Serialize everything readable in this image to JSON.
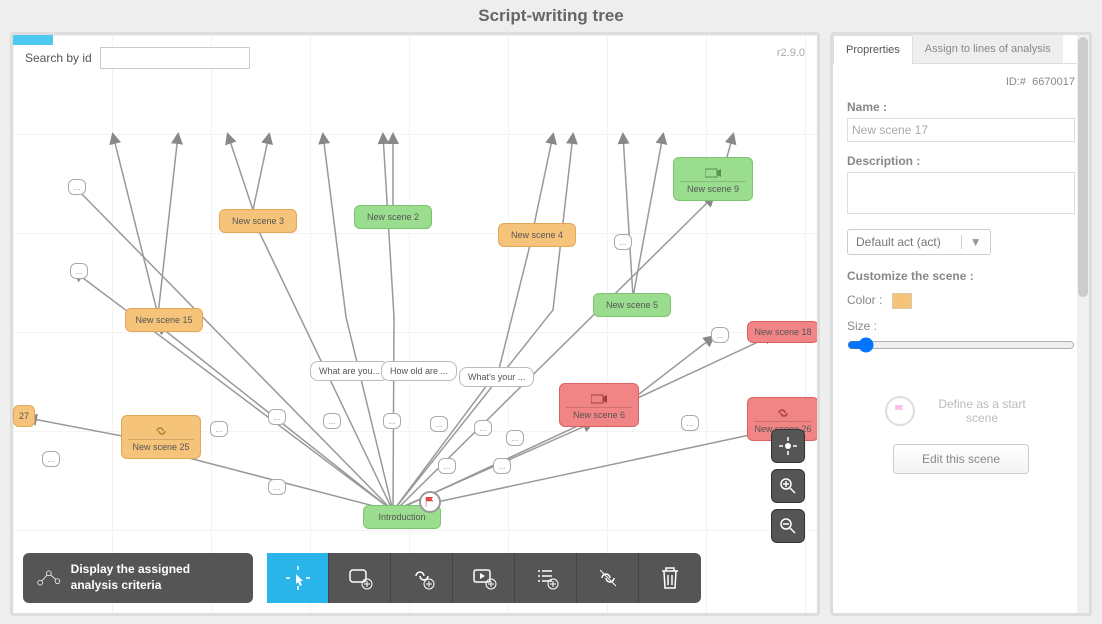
{
  "title": "Script-writing tree",
  "search": {
    "label": "Search by id",
    "value": ""
  },
  "version": "r2.9.0",
  "nodes": {
    "intro": "Introduction",
    "s2": "New scene 2",
    "s3": "New scene 3",
    "s4": "New scene 4",
    "s5": "New scene 5",
    "s6": "New scene 6",
    "s9": "New scene 9",
    "s15": "New scene 15",
    "s18": "New scene 18",
    "s25": "New scene 25",
    "s26": "New scene 26",
    "s27": "27"
  },
  "bubbles": {
    "b1": "What are you...",
    "b2": "How old are ...",
    "b3": "What's your ..."
  },
  "display_btn": "Display the assigned analysis criteria",
  "zoom": {
    "center": "⊙",
    "in": "+",
    "out": "−"
  },
  "tabs": {
    "props": "Proprerties",
    "assign": "Assign to lines of analysis"
  },
  "props": {
    "id_label": "ID:#",
    "id_value": "6670017",
    "name_label": "Name :",
    "name_value": "New scene 17",
    "desc_label": "Description :",
    "desc_value": "",
    "act_select": "Default act (act)",
    "customize": "Customize the scene :",
    "color_label": "Color :",
    "size_label": "Size :",
    "start_label": "Define as a start scene",
    "edit_label": "Edit this scene"
  },
  "dots": "..."
}
